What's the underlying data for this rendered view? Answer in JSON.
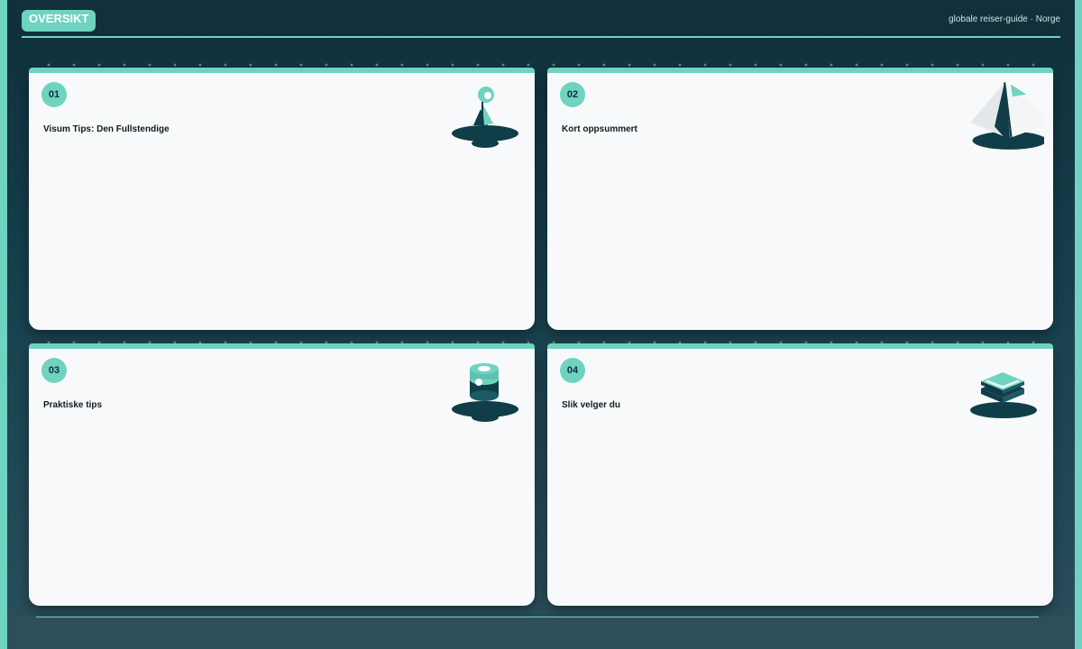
{
  "header": {
    "title": "OVERSIKT",
    "subtitle": "globale reiser-guide · Norge"
  },
  "cards": [
    {
      "number": "01",
      "title": "Visum Tips: Den Fullstendige",
      "icon": "sailboat-icon"
    },
    {
      "number": "02",
      "title": "Kort oppsummert",
      "icon": "tent-icon"
    },
    {
      "number": "03",
      "title": "Praktiske tips",
      "icon": "coin-stack-icon"
    },
    {
      "number": "04",
      "title": "Slik velger du",
      "icon": "book-stack-icon"
    }
  ],
  "colors": {
    "accent": "#6fd3c0",
    "background": "#17404d",
    "card": "#f8f9fb",
    "dark": "#0f3d48"
  }
}
